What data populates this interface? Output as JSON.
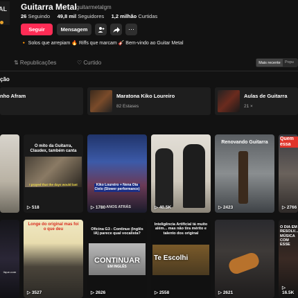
{
  "profile": {
    "avatar_fragment": "AL",
    "name": "Guitarra Metal",
    "handle": "guitarmetalgm",
    "following_count": "26",
    "following_label": "Seguindo",
    "followers_count": "49,8 mil",
    "followers_label": "Seguidores",
    "likes_count": "1,2 milhão",
    "likes_label": "Curtidas",
    "follow_label": "Seguir",
    "message_label": "Mensagem",
    "bio": "🔸 Solos que arrepiam 🔥 Riffs que marcam 🎸 Bem-vindo ao Guitar Metal"
  },
  "tabs": [
    {
      "label": "⇅ Republicações"
    },
    {
      "label": "♡ Curtido"
    }
  ],
  "sort": {
    "recent": "Mais recente",
    "popular": "Popu"
  },
  "collections": {
    "title": "ção",
    "items": [
      {
        "title": "nho Afram",
        "subtitle": ""
      },
      {
        "title": "Maratona Kiko Loureiro",
        "subtitle": "82 Estases"
      },
      {
        "title": "Aulas de Guitarra",
        "subtitle": "21 ×"
      }
    ]
  },
  "videos": [
    {
      "views": "",
      "caption": ""
    },
    {
      "views": "518",
      "caption": "O mito da Guitarra, Claudex, também canta",
      "subcaption": "I prayed that the days would last"
    },
    {
      "views": "1780",
      "caption": "Kiko Loureiro + Nena Ota Cielo (Slower performance)",
      "subcaption": "ANOS ATRÁS"
    },
    {
      "views": "40.5K",
      "caption": ""
    },
    {
      "views": "2423",
      "caption": "Renovando Guitarra"
    },
    {
      "views": "2766",
      "caption": "Quem essa"
    },
    {
      "views": "",
      "caption": "lique.com"
    },
    {
      "views": "3527",
      "caption": "Longe do original mas foi o que deu"
    },
    {
      "views": "2626",
      "caption": "Oficina G3 - Continue (Inglês IA) parece qual vocalista?",
      "subcaption": "CONTINUAR",
      "subsub": "EM INGLÊS"
    },
    {
      "views": "2558",
      "caption": "Inteligência Artificial tá muito além... mas não tira mérito e talento dos original",
      "subcaption": "Te Escolhi"
    },
    {
      "views": "2621",
      "caption": ""
    },
    {
      "views": "16.5K",
      "caption": "O DIA EM RESOLV... MÚSICA COM ESSE"
    }
  ],
  "colors": {
    "accent": "#fe2c55",
    "background": "#121212"
  }
}
